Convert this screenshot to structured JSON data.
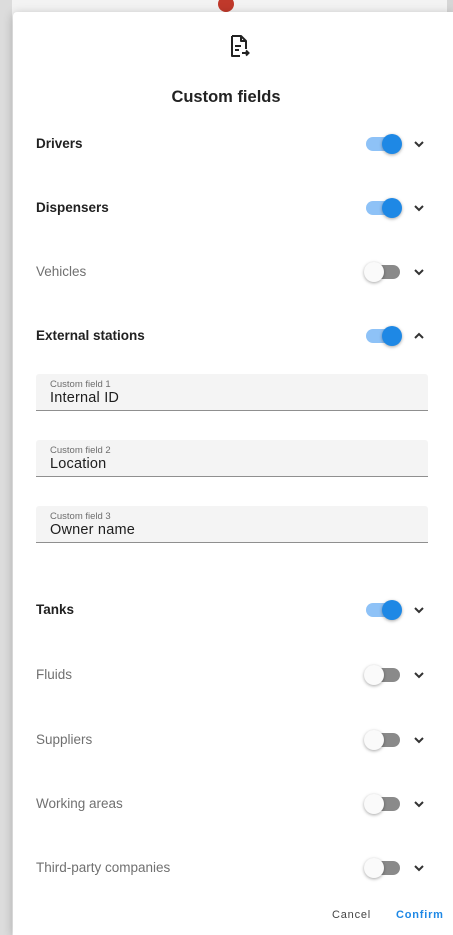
{
  "dialog": {
    "title": "Custom fields",
    "icon": "document-export-icon"
  },
  "sections": [
    {
      "label": "Drivers",
      "enabled": true,
      "expanded": false
    },
    {
      "label": "Dispensers",
      "enabled": true,
      "expanded": false
    },
    {
      "label": "Vehicles",
      "enabled": false,
      "expanded": false
    },
    {
      "label": "External stations",
      "enabled": true,
      "expanded": true,
      "fields": [
        {
          "label": "Custom field 1",
          "value": "Internal ID"
        },
        {
          "label": "Custom field 2",
          "value": "Location"
        },
        {
          "label": "Custom field 3",
          "value": "Owner name"
        }
      ]
    },
    {
      "label": "Tanks",
      "enabled": true,
      "expanded": false
    },
    {
      "label": "Fluids",
      "enabled": false,
      "expanded": false
    },
    {
      "label": "Suppliers",
      "enabled": false,
      "expanded": false
    },
    {
      "label": "Working areas",
      "enabled": false,
      "expanded": false
    },
    {
      "label": "Third-party companies",
      "enabled": false,
      "expanded": false
    }
  ],
  "actions": {
    "cancel": "Cancel",
    "confirm": "Confirm"
  },
  "colors": {
    "accent": "#1e88e5",
    "toggle_track_on": "#8ec2f7",
    "toggle_track_off": "#8a8a8a"
  }
}
